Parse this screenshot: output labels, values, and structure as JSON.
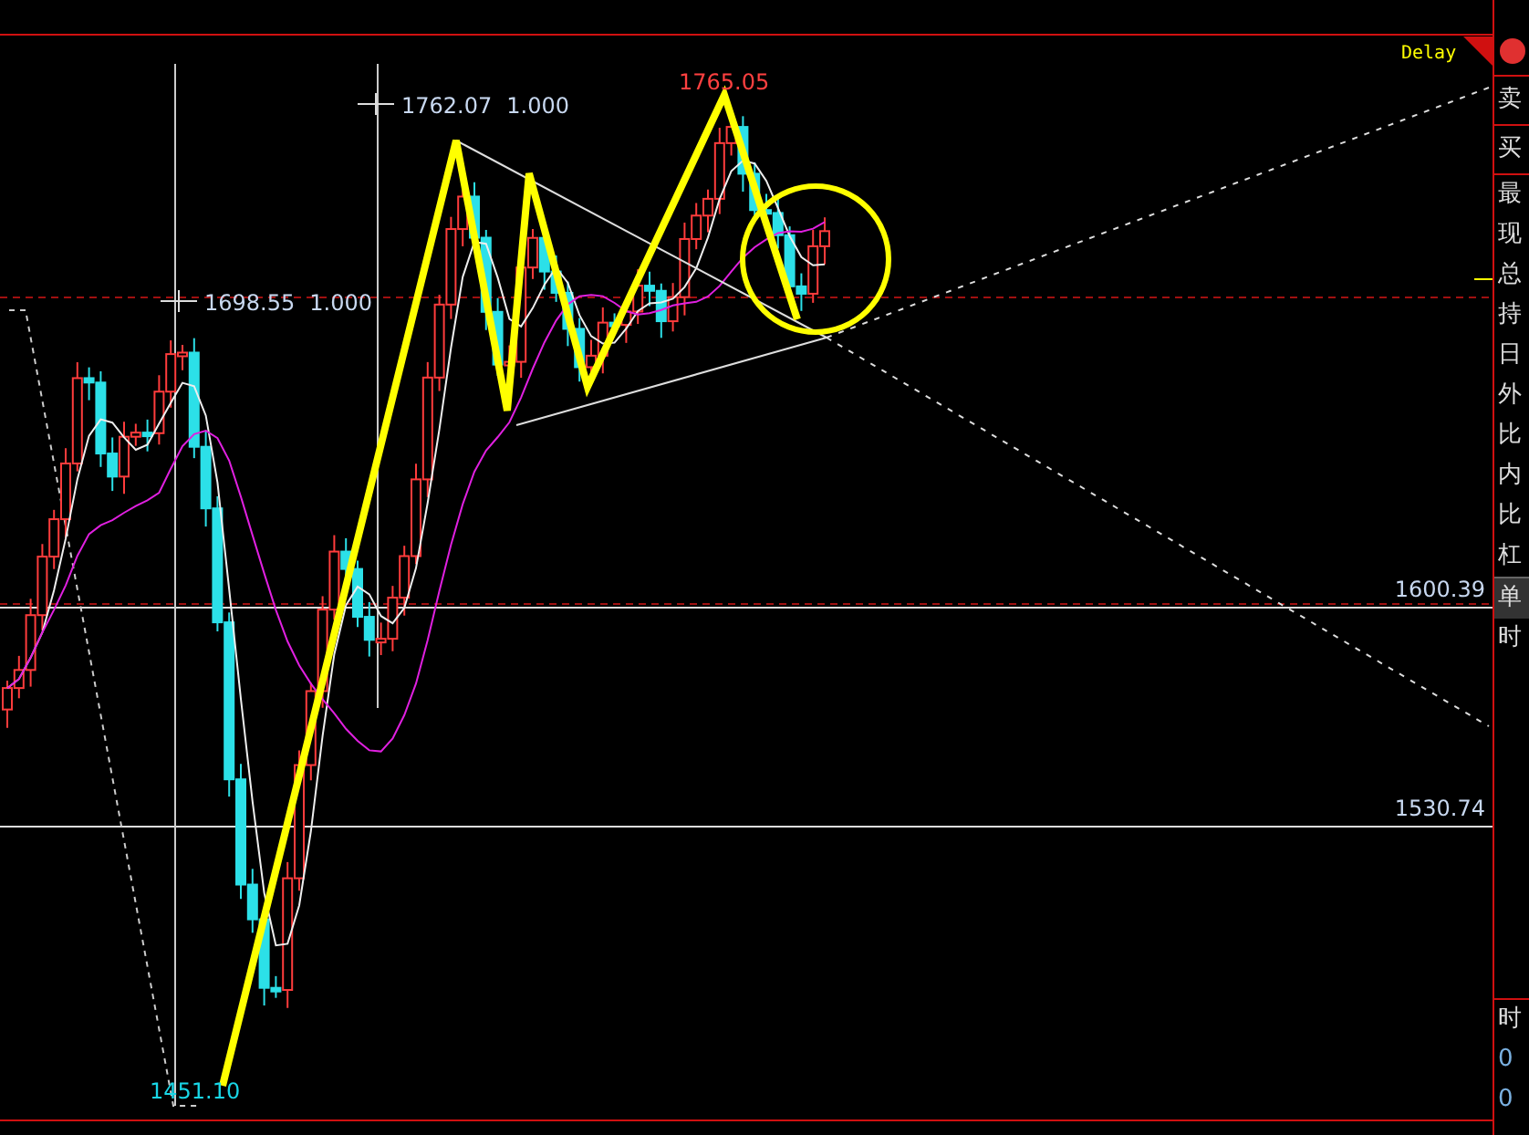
{
  "chart": {
    "status_label": "Delay",
    "markers": [
      {
        "price": "1762.07",
        "ratio": "1.000"
      },
      {
        "price": "1698.55",
        "ratio": "1.000"
      }
    ],
    "extremes": [
      {
        "kind": "high",
        "text": "1765.05"
      },
      {
        "kind": "low",
        "text": "1451.10"
      }
    ],
    "levels": [
      {
        "text": "1600.39"
      },
      {
        "text": "1530.74"
      }
    ]
  },
  "side_panel": {
    "items": [
      {
        "kind": "trade",
        "text": "卖"
      },
      {
        "kind": "trade",
        "text": "买"
      },
      {
        "kind": "field",
        "text": "最"
      },
      {
        "kind": "field",
        "text": "现"
      },
      {
        "kind": "field",
        "text": "总"
      },
      {
        "kind": "field",
        "text": "持"
      },
      {
        "kind": "field",
        "text": "日"
      },
      {
        "kind": "field",
        "text": "外"
      },
      {
        "kind": "field",
        "text": "比"
      },
      {
        "kind": "field",
        "text": "内"
      },
      {
        "kind": "field",
        "text": "比"
      },
      {
        "kind": "field",
        "text": "杠"
      },
      {
        "kind": "tab",
        "text": "单"
      },
      {
        "kind": "field",
        "text": "时"
      },
      {
        "kind": "section",
        "text": "时"
      },
      {
        "kind": "value",
        "text": "0"
      },
      {
        "kind": "value",
        "text": "0"
      }
    ]
  }
}
